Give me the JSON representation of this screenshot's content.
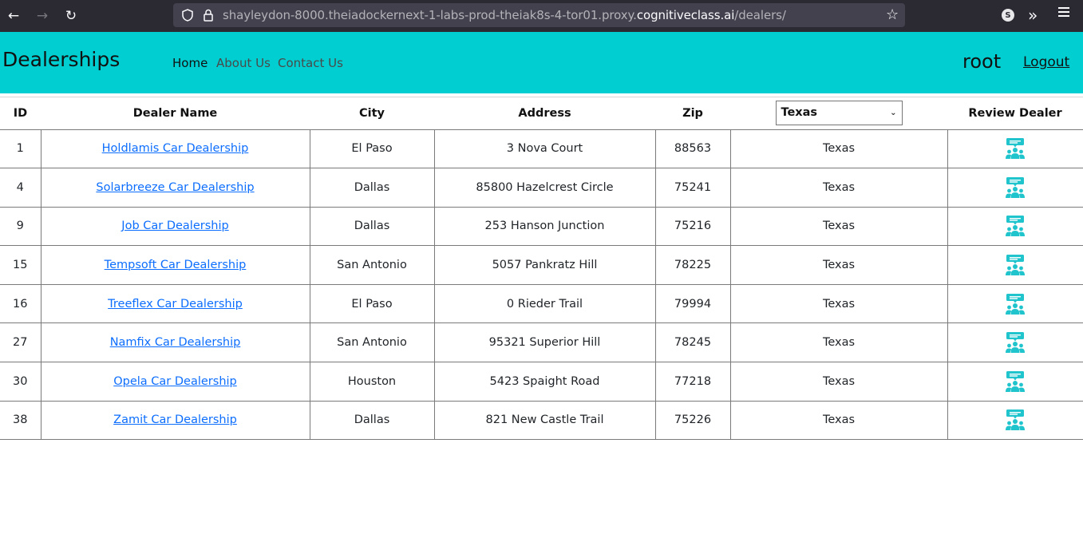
{
  "browser": {
    "url_prefix": "shayleydon-8000.theiadockernext-1-labs-prod-theiak8s-4-tor01.proxy.",
    "url_host": "cognitiveclass.ai",
    "url_suffix": "/dealers/",
    "profile_initial": "S"
  },
  "navbar": {
    "brand": "Dealerships",
    "links": [
      "Home",
      "About Us",
      "Contact Us"
    ],
    "username": "root",
    "logout": "Logout"
  },
  "table": {
    "headers": {
      "id": "ID",
      "name": "Dealer Name",
      "city": "City",
      "address": "Address",
      "zip": "Zip",
      "review": "Review Dealer"
    },
    "state_filter": "Texas",
    "rows": [
      {
        "id": "1",
        "name": "Holdlamis Car Dealership",
        "city": "El Paso",
        "address": "3 Nova Court",
        "zip": "88563",
        "state": "Texas"
      },
      {
        "id": "4",
        "name": "Solarbreeze Car Dealership",
        "city": "Dallas",
        "address": "85800 Hazelcrest Circle",
        "zip": "75241",
        "state": "Texas"
      },
      {
        "id": "9",
        "name": "Job Car Dealership",
        "city": "Dallas",
        "address": "253 Hanson Junction",
        "zip": "75216",
        "state": "Texas"
      },
      {
        "id": "15",
        "name": "Tempsoft Car Dealership",
        "city": "San Antonio",
        "address": "5057 Pankratz Hill",
        "zip": "78225",
        "state": "Texas"
      },
      {
        "id": "16",
        "name": "Treeflex Car Dealership",
        "city": "El Paso",
        "address": "0 Rieder Trail",
        "zip": "79994",
        "state": "Texas"
      },
      {
        "id": "27",
        "name": "Namfix Car Dealership",
        "city": "San Antonio",
        "address": "95321 Superior Hill",
        "zip": "78245",
        "state": "Texas"
      },
      {
        "id": "30",
        "name": "Opela Car Dealership",
        "city": "Houston",
        "address": "5423 Spaight Road",
        "zip": "77218",
        "state": "Texas"
      },
      {
        "id": "38",
        "name": "Zamit Car Dealership",
        "city": "Dallas",
        "address": "821 New Castle Trail",
        "zip": "75226",
        "state": "Texas"
      }
    ]
  },
  "colors": {
    "navbar": "#00ced1",
    "link": "#0d6efd",
    "icon": "#1fc4cc"
  }
}
